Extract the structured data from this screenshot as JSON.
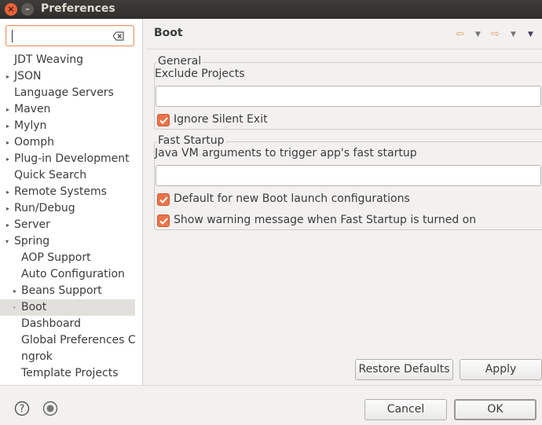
{
  "window": {
    "title": "Preferences",
    "close_glyph": "×",
    "minimize_glyph": "–"
  },
  "filter": {
    "value": "",
    "placeholder": ""
  },
  "tree": [
    {
      "label": "JDT Weaving",
      "twisty": ""
    },
    {
      "label": "JSON",
      "twisty": "▸"
    },
    {
      "label": "Language Servers",
      "twisty": ""
    },
    {
      "label": "Maven",
      "twisty": "▸"
    },
    {
      "label": "Mylyn",
      "twisty": "▸"
    },
    {
      "label": "Oomph",
      "twisty": "▸"
    },
    {
      "label": "Plug-in Development",
      "twisty": "▸"
    },
    {
      "label": "Quick Search",
      "twisty": ""
    },
    {
      "label": "Remote Systems",
      "twisty": "▸"
    },
    {
      "label": "Run/Debug",
      "twisty": "▸"
    },
    {
      "label": "Server",
      "twisty": "▸"
    },
    {
      "label": "Spring",
      "twisty": "▾"
    },
    {
      "label": "AOP Support",
      "twisty": ""
    },
    {
      "label": "Auto Configuration",
      "twisty": ""
    },
    {
      "label": "Beans Support",
      "twisty": "▸"
    },
    {
      "label": "Boot",
      "twisty": "▸",
      "selected": true
    },
    {
      "label": "Dashboard",
      "twisty": ""
    },
    {
      "label": "Global Preferences Cu",
      "twisty": ""
    },
    {
      "label": "ngrok",
      "twisty": ""
    },
    {
      "label": "Template Projects",
      "twisty": ""
    }
  ],
  "page": {
    "title": "Boot"
  },
  "nav": {
    "back_glyph": "⇦",
    "forward_glyph": "⇨",
    "dropdown_glyph": "▼",
    "menu_glyph": "▼"
  },
  "general": {
    "title": "General",
    "exclude_label": "Exclude Projects",
    "exclude_value": "",
    "ignore_silent_exit_label": "Ignore Silent Exit",
    "ignore_silent_exit_checked": true
  },
  "fast_startup": {
    "title": "Fast Startup",
    "jvm_args_label": "Java VM arguments to trigger app's fast startup",
    "jvm_args_value": "",
    "default_launch_label": "Default for new Boot launch configurations",
    "default_launch_checked": true,
    "show_warning_label": "Show warning message when Fast Startup is turned on",
    "show_warning_checked": true
  },
  "buttons": {
    "restore_defaults": "Restore Defaults",
    "apply": "Apply",
    "cancel": "Cancel",
    "ok": "OK"
  },
  "colors": {
    "accent": "#e9744a",
    "titlebar": "#3e3d39"
  }
}
